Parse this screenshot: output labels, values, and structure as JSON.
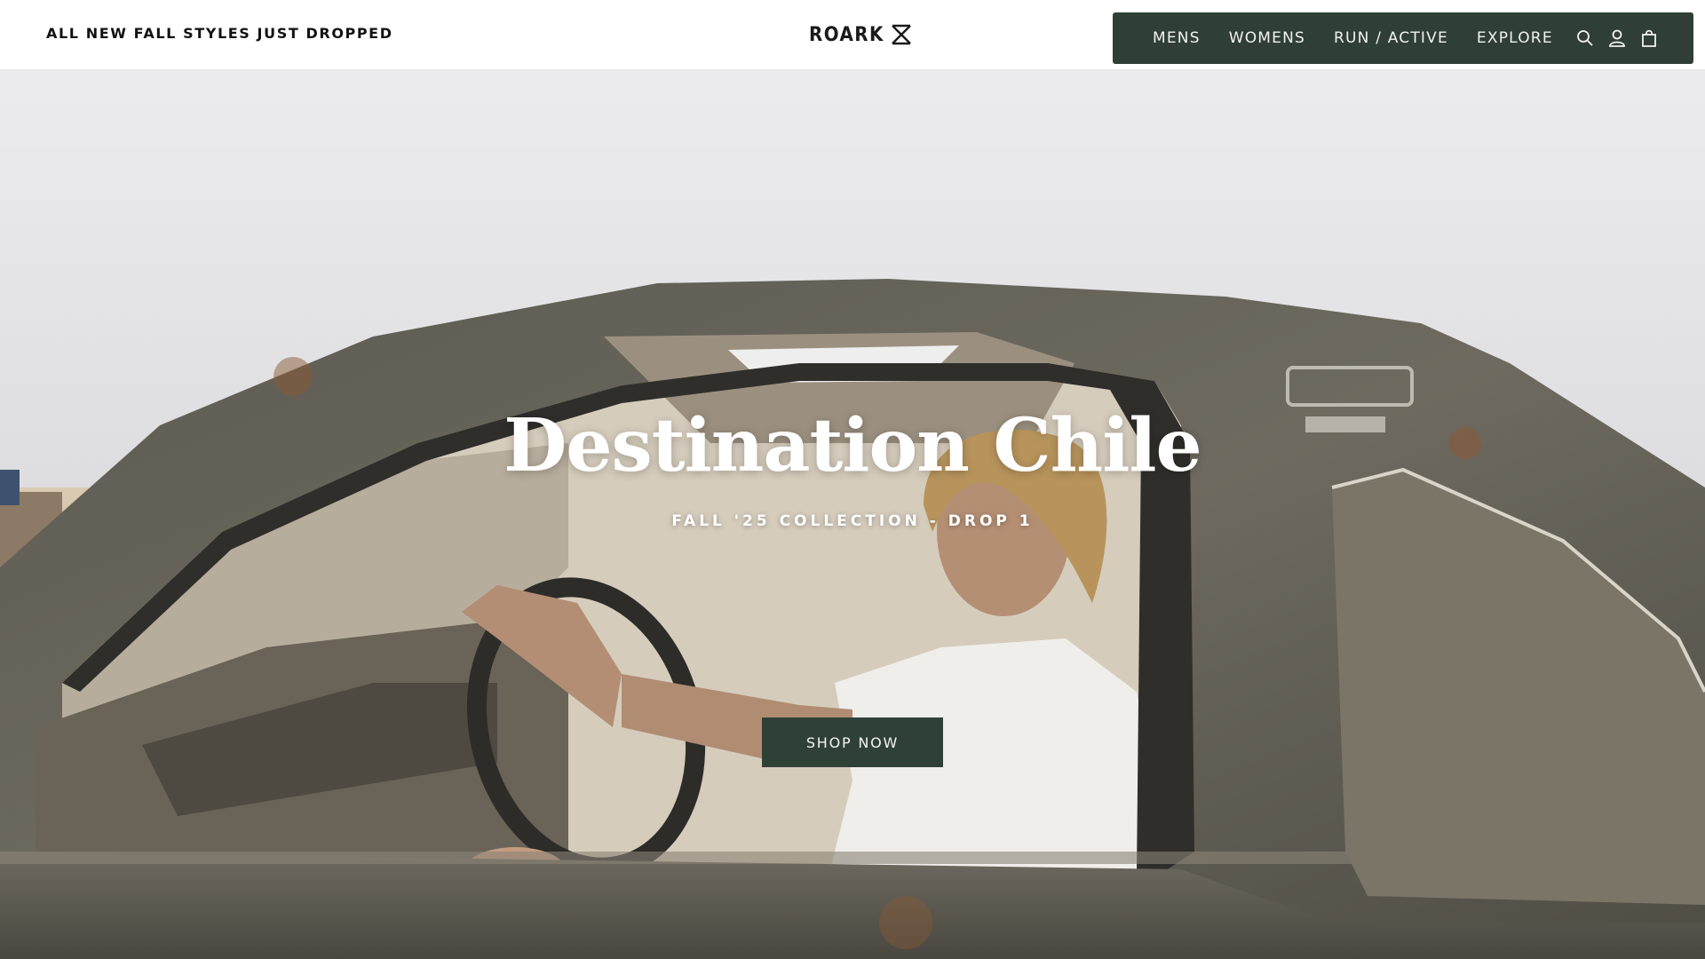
{
  "announcement": {
    "text": "ALL NEW FALL STYLES JUST DROPPED"
  },
  "logo": {
    "text": "ROARK"
  },
  "nav": {
    "items": [
      {
        "label": "MENS"
      },
      {
        "label": "WOMENS"
      },
      {
        "label": "RUN / ACTIVE"
      },
      {
        "label": "EXPLORE"
      }
    ],
    "icons": [
      "search-icon",
      "account-icon",
      "cart-icon"
    ]
  },
  "hero": {
    "title": "Destination Chile",
    "subtitle": "FALL '25 COLLECTION - DROP 1",
    "cta_label": "SHOP NOW"
  },
  "colors": {
    "nav_background": "#2f3f35",
    "button_background": "#2f4137",
    "text_light": "#ffffff"
  }
}
